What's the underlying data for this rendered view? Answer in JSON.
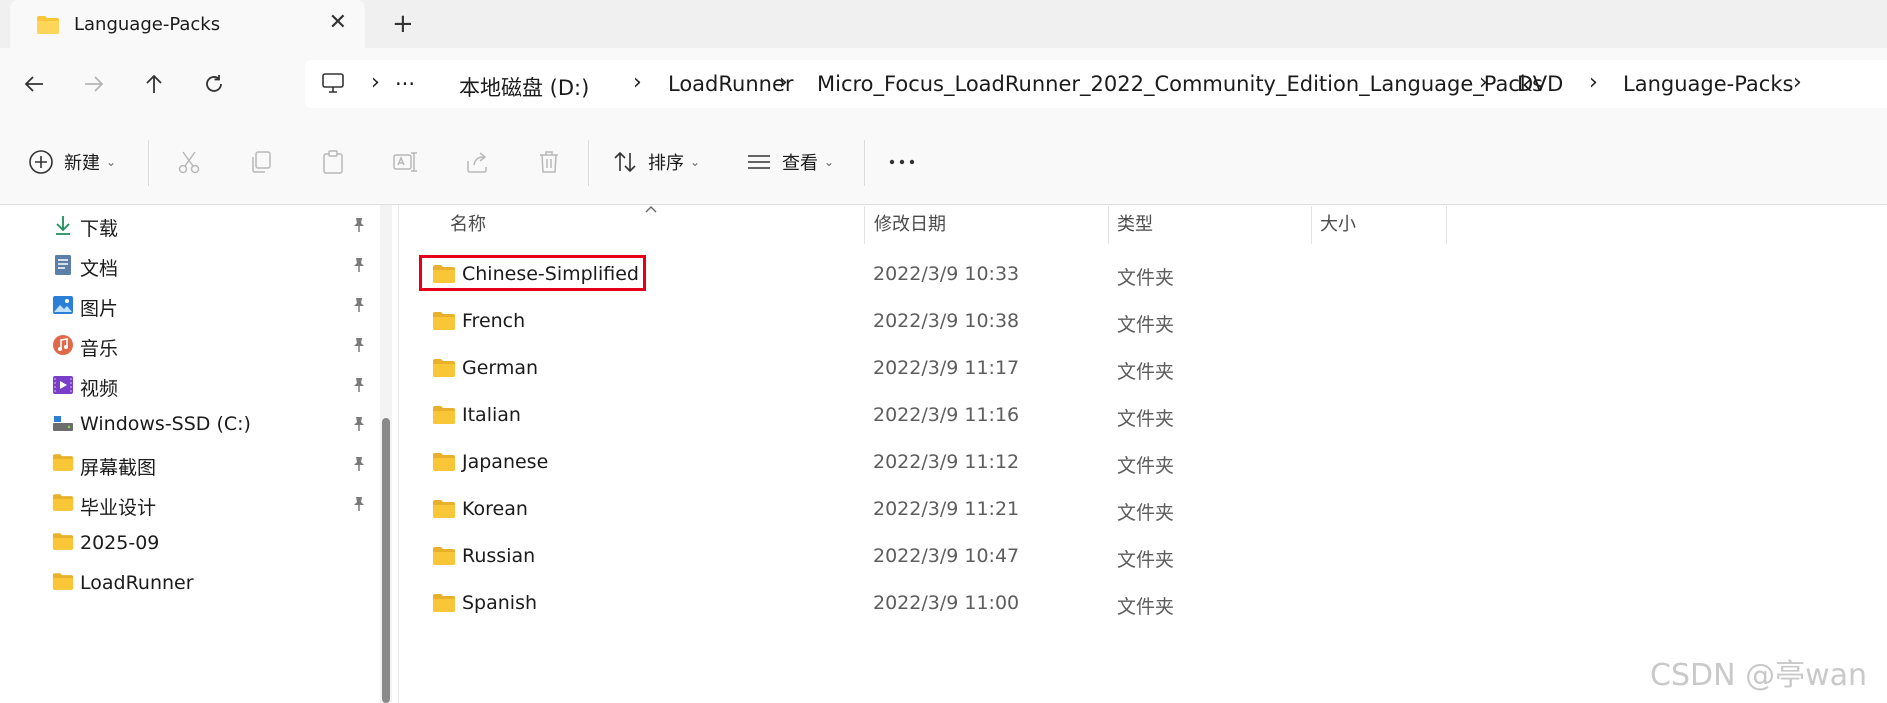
{
  "tab": {
    "title": "Language-Packs",
    "icon": "folder-icon"
  },
  "breadcrumbs": {
    "more": "···",
    "items": [
      "本地磁盘 (D:)",
      "LoadRunner",
      "Micro_Focus_LoadRunner_2022_Community_Edition_Language_Packs",
      "DVD",
      "Language-Packs"
    ]
  },
  "toolbar": {
    "new_label": "新建",
    "sort_label": "排序",
    "view_label": "查看"
  },
  "sidebar": {
    "items": [
      {
        "label": "下载",
        "icon": "download-icon",
        "pinned": true
      },
      {
        "label": "文档",
        "icon": "documents-icon",
        "pinned": true
      },
      {
        "label": "图片",
        "icon": "pictures-icon",
        "pinned": true
      },
      {
        "label": "音乐",
        "icon": "music-icon",
        "pinned": true
      },
      {
        "label": "视频",
        "icon": "videos-icon",
        "pinned": true
      },
      {
        "label": "Windows-SSD (C:)",
        "icon": "drive-icon",
        "pinned": true
      },
      {
        "label": "屏幕截图",
        "icon": "folder-icon",
        "pinned": true
      },
      {
        "label": "毕业设计",
        "icon": "folder-icon",
        "pinned": true
      },
      {
        "label": "2025-09",
        "icon": "folder-icon",
        "pinned": false
      },
      {
        "label": "LoadRunner",
        "icon": "folder-icon",
        "pinned": false
      }
    ]
  },
  "columns": {
    "name": "名称",
    "date": "修改日期",
    "type": "类型",
    "size": "大小"
  },
  "files": [
    {
      "name": "Chinese-Simplified",
      "date": "2022/3/9 10:33",
      "type": "文件夹"
    },
    {
      "name": "French",
      "date": "2022/3/9 10:38",
      "type": "文件夹"
    },
    {
      "name": "German",
      "date": "2022/3/9 11:17",
      "type": "文件夹"
    },
    {
      "name": "Italian",
      "date": "2022/3/9 11:16",
      "type": "文件夹"
    },
    {
      "name": "Japanese",
      "date": "2022/3/9 11:12",
      "type": "文件夹"
    },
    {
      "name": "Korean",
      "date": "2022/3/9 11:21",
      "type": "文件夹"
    },
    {
      "name": "Russian",
      "date": "2022/3/9 10:47",
      "type": "文件夹"
    },
    {
      "name": "Spanish",
      "date": "2022/3/9 11:00",
      "type": "文件夹"
    }
  ],
  "watermark": "CSDN @亭wan",
  "colors": {
    "highlight": "#e5001a",
    "folder": "#f8c636"
  }
}
